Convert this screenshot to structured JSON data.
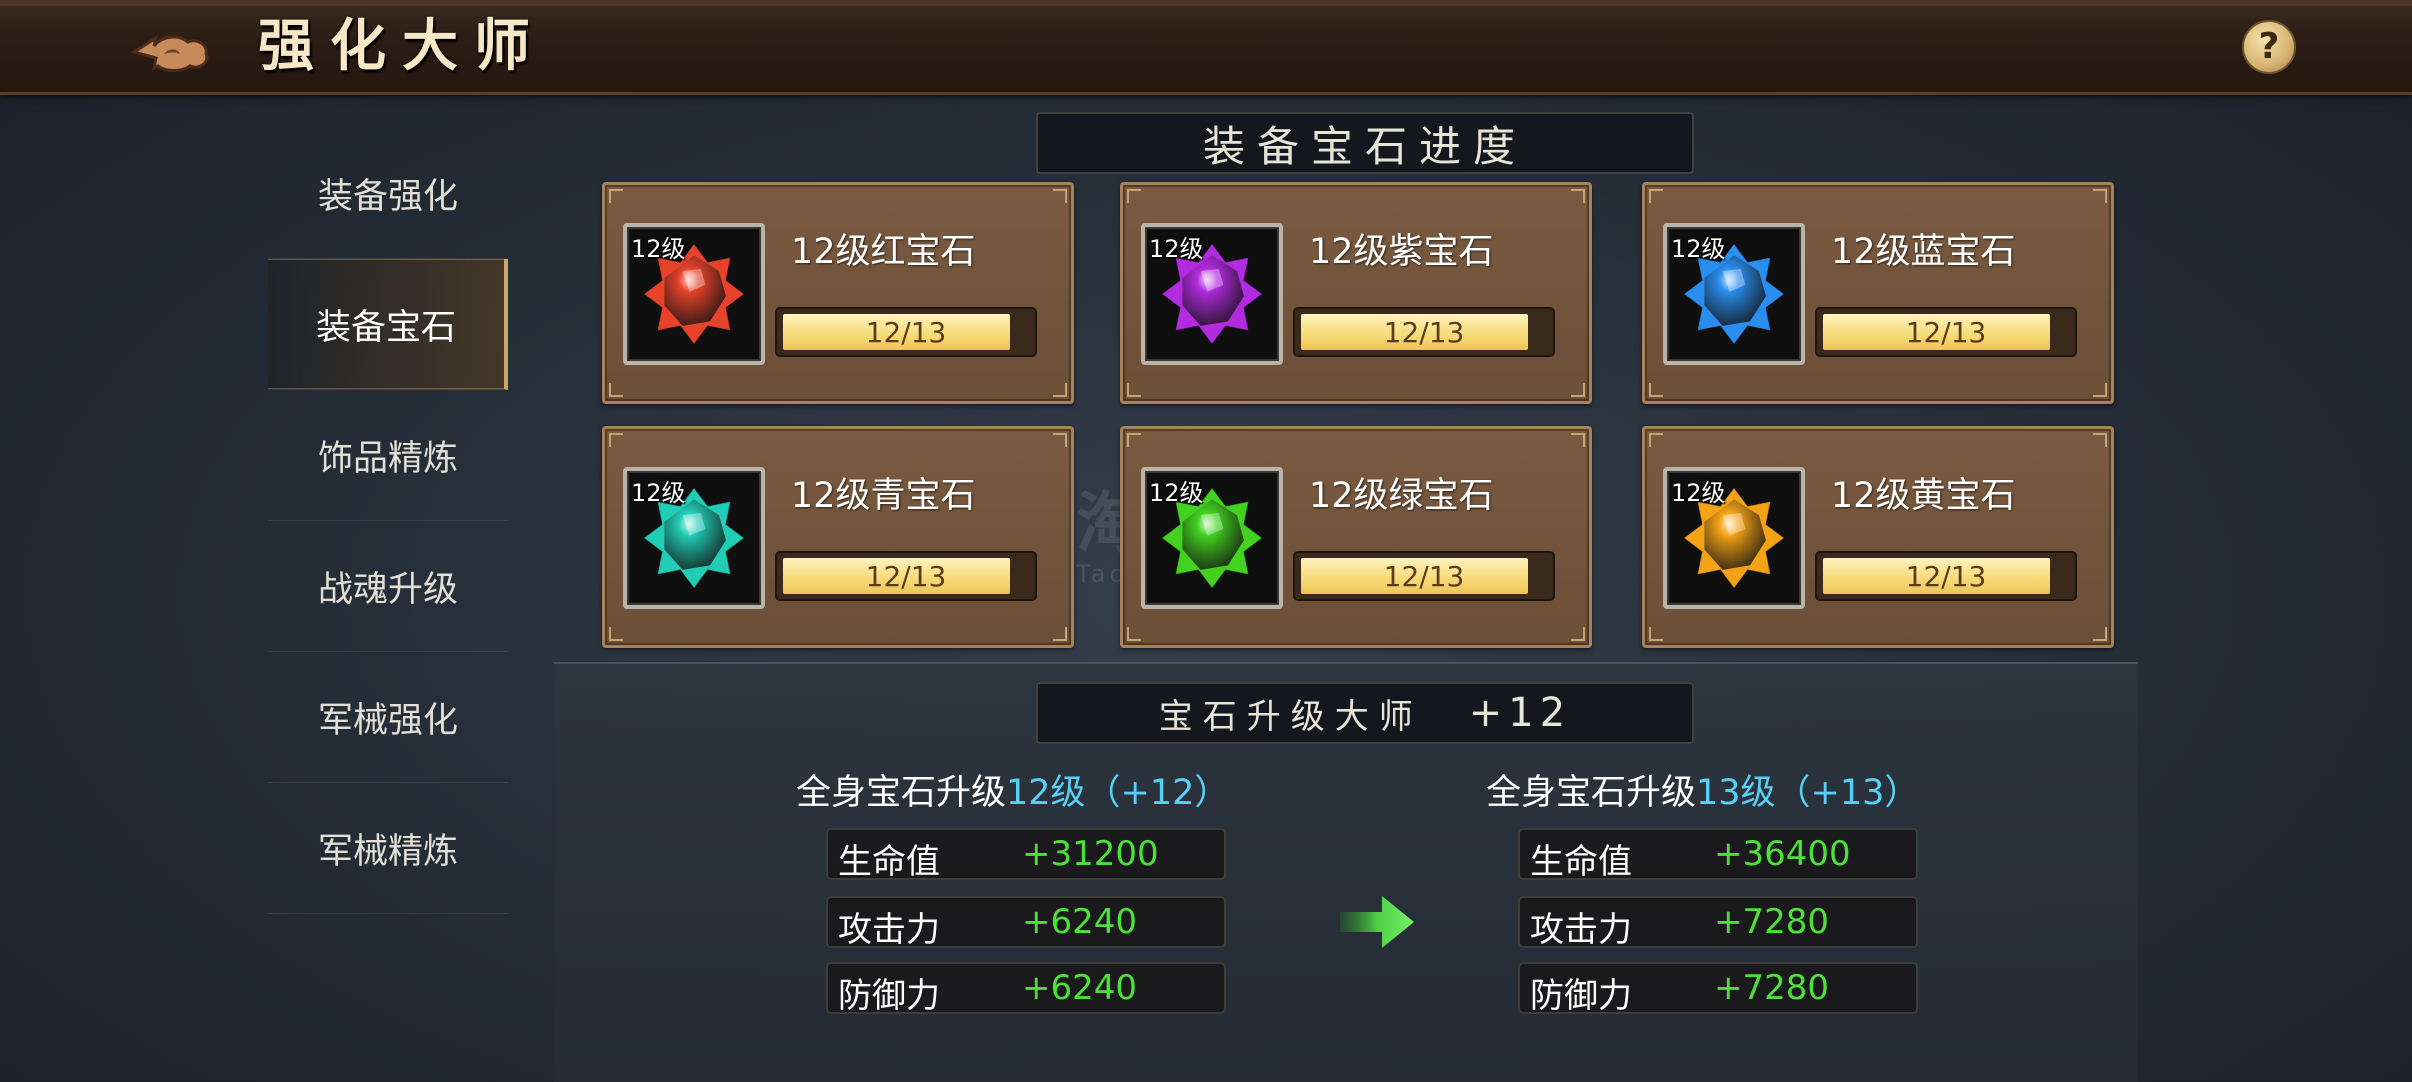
{
  "header": {
    "title": "强化大师",
    "help_label": "?"
  },
  "sidebar": {
    "items": [
      {
        "label": "装备强化"
      },
      {
        "label": "装备宝石",
        "active": true
      },
      {
        "label": "饰品精炼"
      },
      {
        "label": "战魂升级"
      },
      {
        "label": "军械强化"
      },
      {
        "label": "军械精炼"
      }
    ]
  },
  "gem_section": {
    "title": "装备宝石进度",
    "gems": [
      {
        "name": "12级红宝石",
        "level_tag": "12级",
        "progress": "12/13",
        "fill_fraction": 0.923,
        "color": "#e8432a",
        "icon": "red-gem-icon"
      },
      {
        "name": "12级紫宝石",
        "level_tag": "12级",
        "progress": "12/13",
        "fill_fraction": 0.923,
        "color": "#b22be0",
        "icon": "purple-gem-icon"
      },
      {
        "name": "12级蓝宝石",
        "level_tag": "12级",
        "progress": "12/13",
        "fill_fraction": 0.923,
        "color": "#2a8ef0",
        "icon": "blue-gem-icon"
      },
      {
        "name": "12级青宝石",
        "level_tag": "12级",
        "progress": "12/13",
        "fill_fraction": 0.923,
        "color": "#22cdb6",
        "icon": "cyan-gem-icon"
      },
      {
        "name": "12级绿宝石",
        "level_tag": "12级",
        "progress": "12/13",
        "fill_fraction": 0.923,
        "color": "#42d21f",
        "icon": "green-gem-icon"
      },
      {
        "name": "12级黄宝石",
        "level_tag": "12级",
        "progress": "12/13",
        "fill_fraction": 0.923,
        "color": "#f5a316",
        "icon": "yellow-gem-icon"
      }
    ]
  },
  "master_section": {
    "title": "宝石升级大师",
    "plus": "+12",
    "current": {
      "title_prefix": "全身宝石升级",
      "title_level": "12级（+12）",
      "stats": [
        {
          "label": "生命值",
          "value": "+31200"
        },
        {
          "label": "攻击力",
          "value": "+6240"
        },
        {
          "label": "防御力",
          "value": "+6240"
        }
      ]
    },
    "next": {
      "title_prefix": "全身宝石升级",
      "title_level": "13级（+13）",
      "stats": [
        {
          "label": "生命值",
          "value": "+36400"
        },
        {
          "label": "攻击力",
          "value": "+7280"
        },
        {
          "label": "防御力",
          "value": "+7280"
        }
      ]
    }
  },
  "watermark": {
    "text": "淘手游",
    "sub": "Taoshouyou.Com"
  },
  "colors": {
    "accent_gold": "#c9a56b",
    "stat_green": "#4ce039",
    "level_cyan": "#56d1f5",
    "card_brown": "#7a5b41"
  }
}
